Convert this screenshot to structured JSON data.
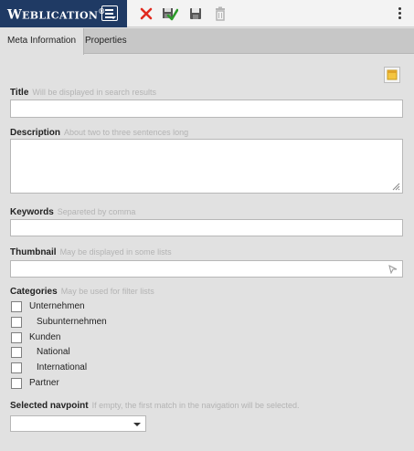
{
  "app": {
    "brand": {
      "first_letter": "W",
      "rest": "EBLICATION",
      "registered": "®"
    },
    "menu_icon": "list-menu-icon"
  },
  "toolbar": {
    "icons": [
      "close-icon",
      "save-publish-icon",
      "save-icon",
      "delete-icon",
      "more-vertical-icon"
    ],
    "colors": {
      "close": "#e12a1f",
      "publish_check": "#2d9a2a",
      "brand_bg": "#1f3a64"
    }
  },
  "tabs": [
    {
      "label": "Meta Information",
      "active": true
    },
    {
      "label": "Properties",
      "active": false
    }
  ],
  "form": {
    "title": {
      "label": "Title",
      "hint": "Will be displayed in search results",
      "value": ""
    },
    "description": {
      "label": "Description",
      "hint": "About two to three sentences long",
      "value": ""
    },
    "keywords": {
      "label": "Keywords",
      "hint": "Separeted by comma",
      "value": ""
    },
    "thumbnail": {
      "label": "Thumbnail",
      "hint": "May be displayed in some lists",
      "value": ""
    },
    "categories": {
      "label": "Categories",
      "hint": "May be used for filter lists",
      "items": [
        {
          "label": "Unternehmen",
          "checked": false,
          "indent": 0
        },
        {
          "label": "Subunternehmen",
          "checked": false,
          "indent": 1
        },
        {
          "label": "Kunden",
          "checked": false,
          "indent": 0
        },
        {
          "label": "National",
          "checked": false,
          "indent": 1
        },
        {
          "label": "International",
          "checked": false,
          "indent": 1
        },
        {
          "label": "Partner",
          "checked": false,
          "indent": 0
        }
      ]
    },
    "navpoint": {
      "label": "Selected navpoint",
      "hint": "If empty, the first match in the navigation will be selected.",
      "value": ""
    }
  }
}
